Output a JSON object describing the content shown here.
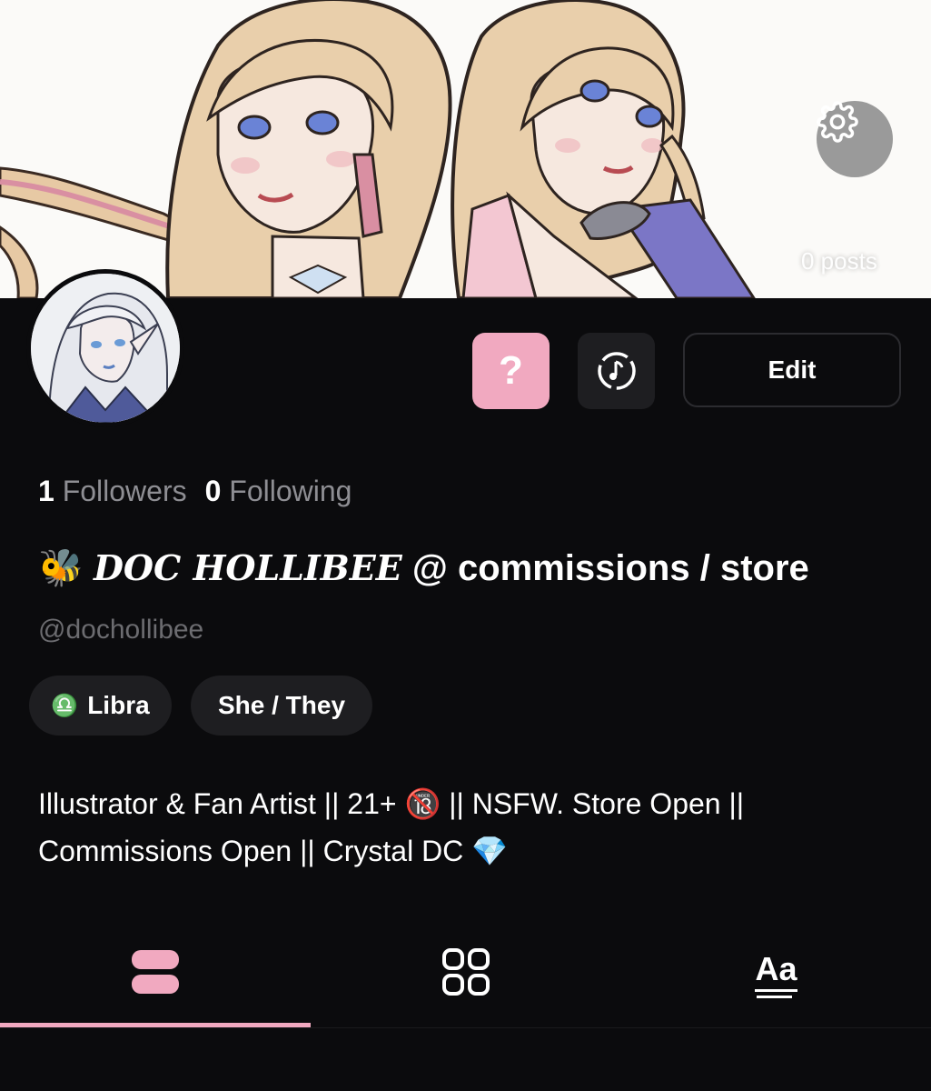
{
  "banner": {
    "posts_count": "0 posts",
    "settings_icon": "gear-icon"
  },
  "profile": {
    "avatar": "avatar-image",
    "actions": {
      "question_label": "?",
      "music_icon": "music-note-icon",
      "edit_label": "Edit"
    },
    "stats": {
      "followers_count": "1",
      "followers_label": "Followers",
      "following_count": "0",
      "following_label": "Following"
    },
    "name": {
      "emoji": "🐝",
      "styled": "DOC HOLLIBEE",
      "rest": " @ commissions / store"
    },
    "handle": "@dochollibee",
    "chips": {
      "libra_symbol": "♎",
      "libra_label": "Libra",
      "pronouns": "She / They"
    },
    "bio": {
      "line1": "Illustrator & Fan Artist || 21+ 🔞 || NSFW. Store Open ||",
      "line2": "Commissions Open || Crystal DC 💎"
    }
  },
  "tabs": {
    "active": "posts",
    "items": [
      "posts-view-icon",
      "grid-view-icon",
      "text-view-icon"
    ],
    "text_tab_label": "Aa",
    "accent": "#f1a9c0"
  }
}
